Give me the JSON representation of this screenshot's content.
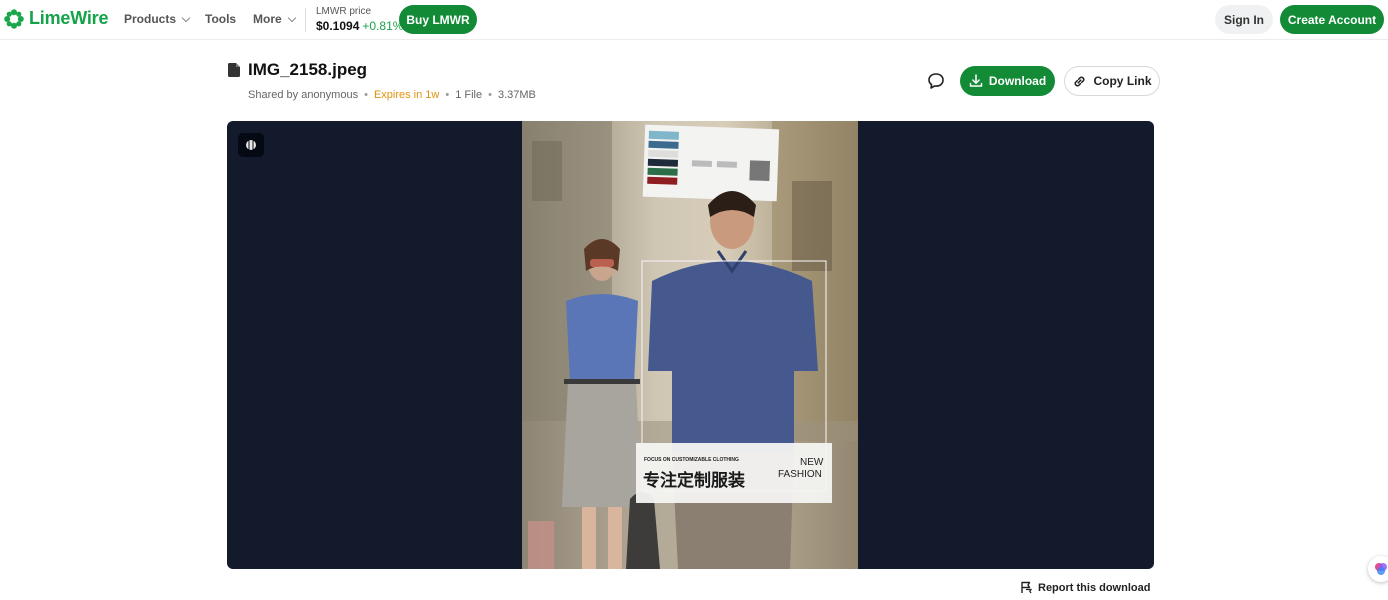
{
  "header": {
    "brand": "LimeWire",
    "nav": [
      {
        "label": "Products",
        "has_dropdown": true
      },
      {
        "label": "Tools",
        "has_dropdown": false
      },
      {
        "label": "More",
        "has_dropdown": true
      }
    ],
    "price_label": "LMWR price",
    "price_value": "$0.1094",
    "price_change": "+0.81%",
    "buy_label": "Buy LMWR",
    "signin_label": "Sign In",
    "create_label": "Create Account"
  },
  "file": {
    "name": "IMG_2158.jpeg",
    "shared_by": "Shared by anonymous",
    "expires": "Expires in 1w",
    "count": "1 File",
    "size": "3.37MB"
  },
  "actions": {
    "download_label": "Download",
    "copy_label": "Copy Link"
  },
  "photo": {
    "caption_small": "FOCUS ON CUSTOMIZABLE CLOTHING",
    "caption_cn": "专注定制服装",
    "caption_new": "NEW",
    "caption_fashion": "FASHION"
  },
  "footer": {
    "report_label": "Report this download"
  },
  "colors": {
    "brand_green": "#138a36",
    "expires_orange": "#e0920c",
    "preview_bg": "#121a2c"
  },
  "icons": [
    "limewire-logo-icon",
    "chevron-down-icon",
    "file-icon",
    "comment-icon",
    "download-icon",
    "link-icon",
    "preview-mode-icon",
    "flag-icon",
    "assistant-icon"
  ]
}
